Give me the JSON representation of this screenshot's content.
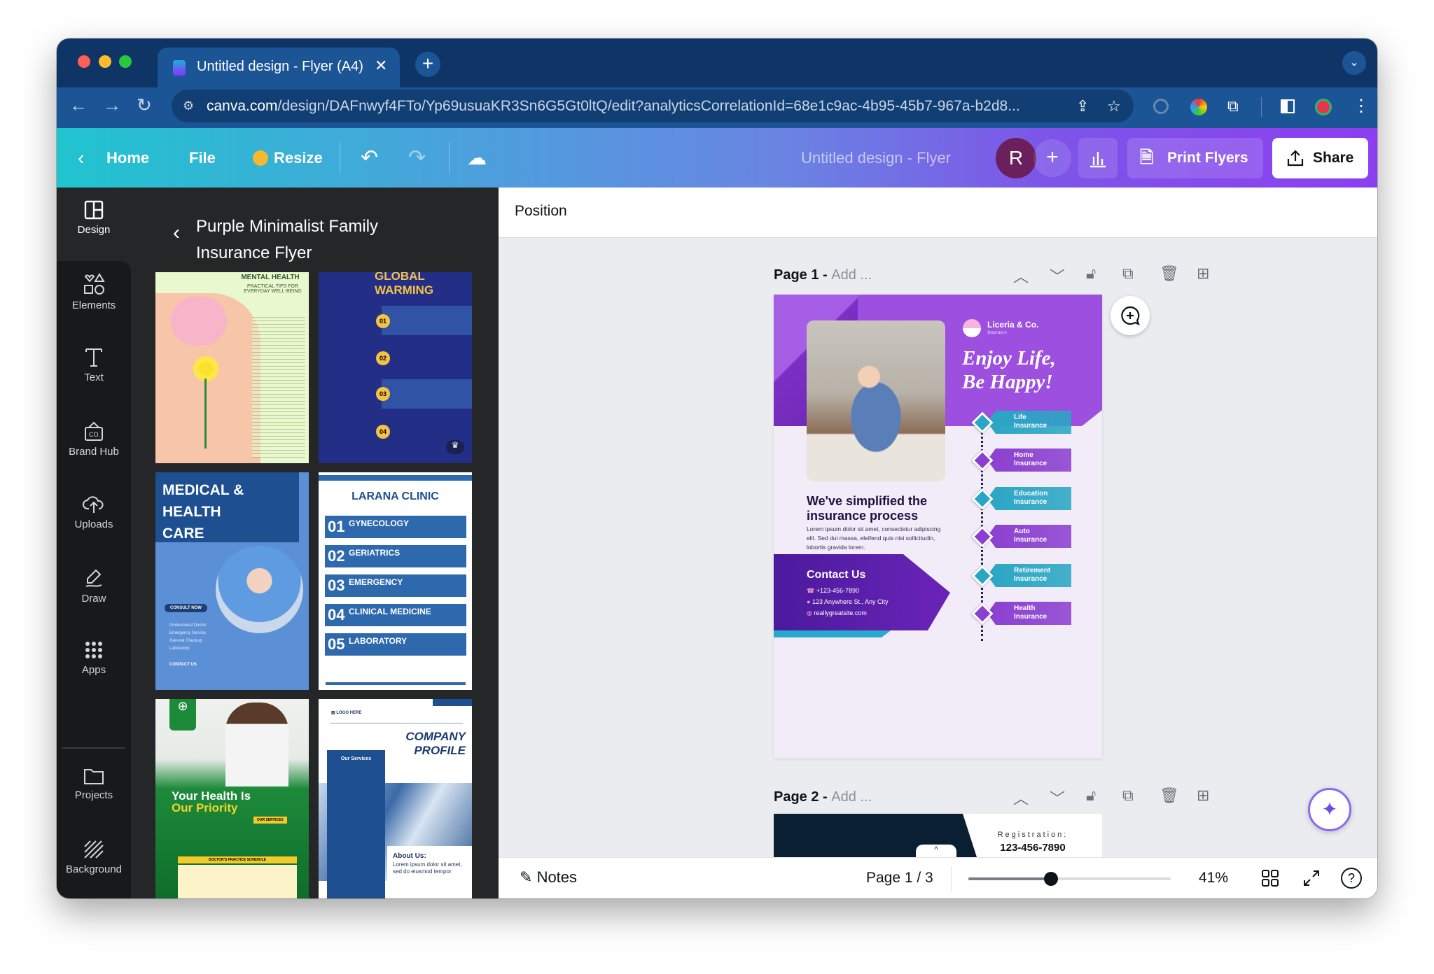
{
  "browser": {
    "tab_title": "Untitled design - Flyer (A4)",
    "url_domain": "canva.com",
    "url_path": "/design/DAFnwyf4FTo/Yp69usuaKR3Sn6G5Gt0ltQ/edit?analyticsCorrelationId=68e1c9ac-4b95-45b7-967a-b2d8..."
  },
  "toolbar": {
    "home": "Home",
    "file": "File",
    "resize": "Resize",
    "doc_title": "Untitled design - Flyer (A4)",
    "avatar": "R",
    "print": "Print Flyers",
    "share": "Share"
  },
  "rail": {
    "items": [
      {
        "label": "Design",
        "icon": "layout-icon"
      },
      {
        "label": "Elements",
        "icon": "shapes-icon"
      },
      {
        "label": "Text",
        "icon": "text-icon"
      },
      {
        "label": "Brand Hub",
        "icon": "brand-icon"
      },
      {
        "label": "Uploads",
        "icon": "upload-icon"
      },
      {
        "label": "Draw",
        "icon": "draw-icon"
      },
      {
        "label": "Apps",
        "icon": "apps-icon"
      },
      {
        "label": "Projects",
        "icon": "folder-icon"
      },
      {
        "label": "Background",
        "icon": "background-icon"
      }
    ]
  },
  "panel": {
    "title_line1": "Purple Minimalist Family",
    "title_line2": "Insurance Flyer",
    "templates": [
      {
        "title": "MENTAL HEALTH",
        "subtitle": "PRACTICAL TIPS FOR EVERYDAY WELL-BEING"
      },
      {
        "title": "GLOBAL WARMING",
        "items": [
          "01",
          "02",
          "03",
          "04"
        ]
      },
      {
        "title": "MEDICAL & HEALTH CARE",
        "button": "CONSULT NOW",
        "items": [
          "Professional Doctor",
          "Emergency Service",
          "General Checkup",
          "Laboratory"
        ],
        "contact": "CONTACT US"
      },
      {
        "title": "LARANA CLINIC",
        "items": [
          {
            "n": "01",
            "t": "GYNECOLOGY"
          },
          {
            "n": "02",
            "t": "GERIATRICS"
          },
          {
            "n": "03",
            "t": "EMERGENCY"
          },
          {
            "n": "04",
            "t": "CLINICAL MEDICINE"
          },
          {
            "n": "05",
            "t": "LABORATORY"
          }
        ]
      },
      {
        "title1": "Your Health Is",
        "title2": "Our Priority",
        "services": "OUR SERVICES",
        "schedule": "DOCTOR'S PRACTICE SCHEDULE"
      },
      {
        "logo": "LOGO HERE",
        "title1": "COMPANY",
        "title2": "PROFILE",
        "services": "Our Services",
        "about": "About Us:",
        "about_text": "Lorem ipsum dolor sit amet, sed do eiusmod tempor"
      }
    ]
  },
  "main": {
    "position": "Position",
    "page1": {
      "label": "Page 1 -",
      "add": "Add ..."
    },
    "page2": {
      "label": "Page 2 -",
      "add": "Add ..."
    },
    "page2_preview": {
      "registration": "Registration:",
      "phone": "123-456-7890"
    }
  },
  "flyer": {
    "brand": "Liceria & Co.",
    "brand_sub": "Insurance",
    "headline1": "Enjoy Life,",
    "headline2": "Be Happy!",
    "sub1": "We've simplified the",
    "sub2": "insurance process",
    "lorem": "Lorem ipsum dolor sit amet, consectetur adipiscing elit. Sed dui massa, eleifend quis nisi sollicitudin, lobortis gravida lorem.",
    "contact_title": "Contact Us",
    "phone": "+123-456-7890",
    "address": "123 Anywhere St., Any City",
    "website": "reallygreatsite.com",
    "insurance": [
      {
        "l1": "Life",
        "l2": "Insurance",
        "color": "#2aa6c4"
      },
      {
        "l1": "Home",
        "l2": "Insurance",
        "color": "#8b3fd0"
      },
      {
        "l1": "Education",
        "l2": "Insurance",
        "color": "#2aa6c4"
      },
      {
        "l1": "Auto",
        "l2": "Insurance",
        "color": "#8b3fd0"
      },
      {
        "l1": "Retirement",
        "l2": "Insurance",
        "color": "#2aa6c4"
      },
      {
        "l1": "Health",
        "l2": "Insurance",
        "color": "#8b3fd0"
      }
    ]
  },
  "bottom": {
    "notes": "Notes",
    "page_indicator": "Page 1 / 3",
    "zoom": "41%",
    "zoom_value": 41
  },
  "colors": {
    "accent_purple": "#8b3fd0",
    "teal": "#2aa6c4",
    "chrome_navy": "#0f3566"
  }
}
